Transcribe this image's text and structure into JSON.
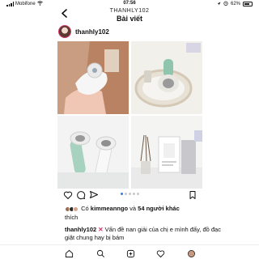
{
  "status_bar": {
    "carrier": "Mobifone",
    "time": "07:56",
    "battery": "62%"
  },
  "header": {
    "username": "THANHLY102",
    "title": "Bài viết"
  },
  "post": {
    "author": "thanhly102",
    "likes": {
      "prefix": "Có",
      "liker": "kimmeanngo",
      "middle": "và",
      "others": "54 người khác",
      "suffix": "thích"
    },
    "caption": {
      "author": "thanhly102",
      "text": "Vấn đề nan giải của chị e mình đấy, đồ đạc giặt chung hay bị bám"
    },
    "carousel": {
      "count": 5,
      "active": 1
    }
  },
  "icons": {
    "back": "chevron-left-icon",
    "more": "more-dots-icon",
    "like": "heart-icon",
    "comment": "comment-icon",
    "share": "send-icon",
    "save": "bookmark-icon"
  }
}
